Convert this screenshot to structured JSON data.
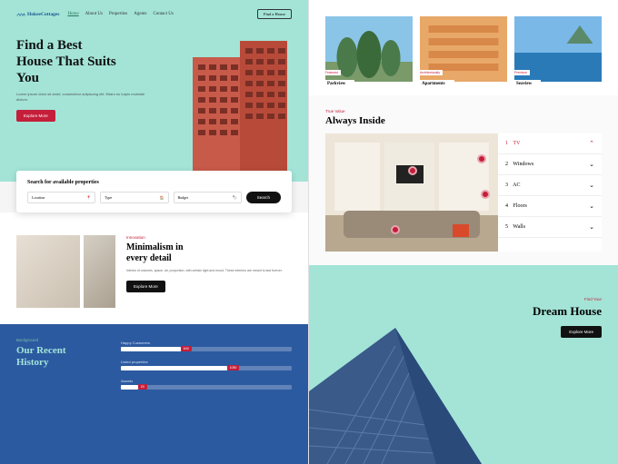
{
  "nav": {
    "logo": "HokeeCottages",
    "links": [
      "Home",
      "About Us",
      "Properties",
      "Agents",
      "Contact Us"
    ],
    "cta": "Find a House"
  },
  "hero": {
    "title_l1": "Find a Best",
    "title_l2": "House That Suits",
    "title_l3": "You",
    "sub": "Lorem ipsum dolor sit amet, consectetur adipiscing elit. Etiam eu turpis molestie dictum.",
    "btn": "Explore More"
  },
  "search": {
    "title": "Search for available properties",
    "f1": "Location",
    "f2": "Type",
    "f3": "Budget",
    "btn": "Search"
  },
  "min": {
    "eyebrow": "Innovation",
    "title_l1": "Minimalism in",
    "title_l2": "every detail",
    "sub": "Interior of volumes, space, air, proportion, with certain light and mood. These interiors are meant to last forever.",
    "btn": "Explore More"
  },
  "hist": {
    "eyebrow": "Background",
    "title_l1": "Our Recent",
    "title_l2": "History",
    "stats": [
      {
        "label": "Happy Customers",
        "val": "640",
        "pct": 35
      },
      {
        "label": "Listed properties",
        "val": "1050",
        "pct": 62
      },
      {
        "label": "Awards",
        "val": "20",
        "pct": 10
      }
    ]
  },
  "gallery": {
    "items": [
      {
        "eyebrow": "Featured",
        "label": "Parkview"
      },
      {
        "eyebrow": "Architecturally",
        "label": "Apartments"
      },
      {
        "eyebrow": "Premium",
        "label": "Seaview"
      }
    ]
  },
  "always": {
    "eyebrow": "True Value",
    "title": "Always Inside",
    "items": [
      {
        "n": "1",
        "label": "TV"
      },
      {
        "n": "2",
        "label": "Windows"
      },
      {
        "n": "3",
        "label": "AC"
      },
      {
        "n": "4",
        "label": "Floors"
      },
      {
        "n": "5",
        "label": "Walls"
      }
    ]
  },
  "dream": {
    "eyebrow": "Find Your",
    "title": "Dream House",
    "btn": "Explore More"
  }
}
